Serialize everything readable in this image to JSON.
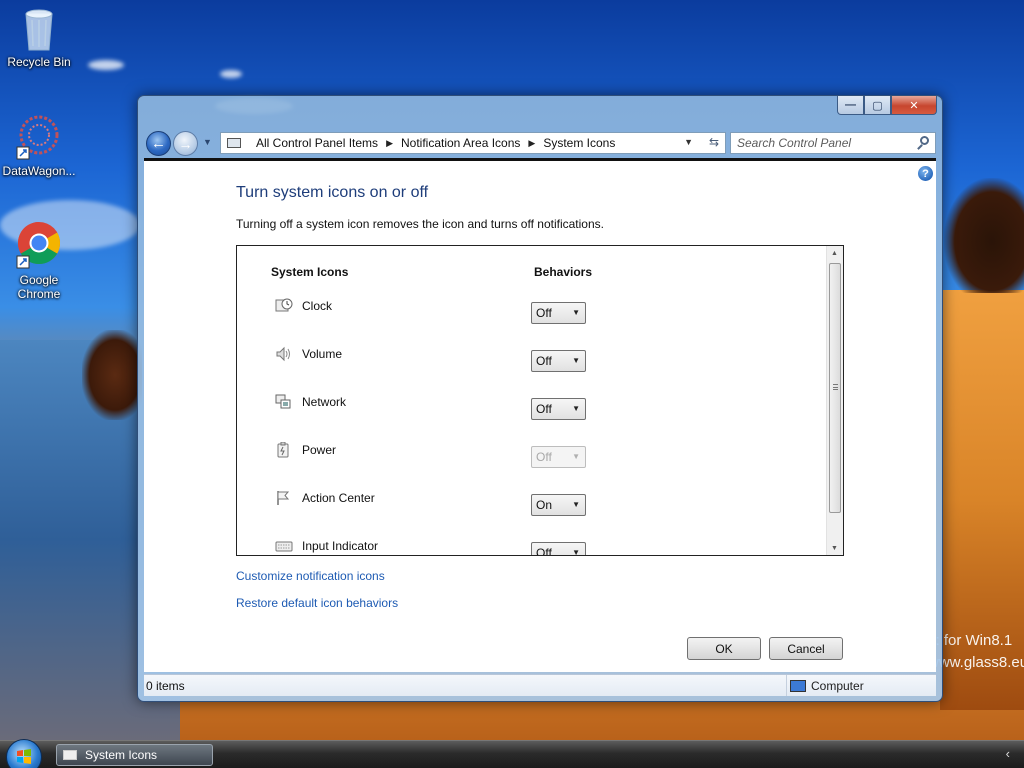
{
  "desktop": {
    "icons": [
      {
        "label": "Recycle Bin"
      },
      {
        "label": "DataWagon..."
      },
      {
        "label": "Google Chrome"
      }
    ],
    "watermark": [
      "s: for Win8.1",
      "www.glass8.eu"
    ]
  },
  "window": {
    "caption_buttons": {
      "minimize": "—",
      "maximize": "▢",
      "close": "✕"
    },
    "nav": {
      "back": "←",
      "forward": "→"
    },
    "breadcrumbs": [
      "All Control Panel Items",
      "Notification Area Icons",
      "System Icons"
    ],
    "search_placeholder": "Search Control Panel",
    "help": "?",
    "title": "Turn system icons on or off",
    "description": "Turning off a system icon removes the icon and turns off notifications.",
    "columns": {
      "icons": "System Icons",
      "behaviors": "Behaviors"
    },
    "rows": [
      {
        "label": "Clock",
        "value": "Off",
        "icon": "clock-icon",
        "disabled": false
      },
      {
        "label": "Volume",
        "value": "Off",
        "icon": "volume-icon",
        "disabled": false
      },
      {
        "label": "Network",
        "value": "Off",
        "icon": "network-icon",
        "disabled": false
      },
      {
        "label": "Power",
        "value": "Off",
        "icon": "power-icon",
        "disabled": true
      },
      {
        "label": "Action Center",
        "value": "On",
        "icon": "flag-icon",
        "disabled": false
      },
      {
        "label": "Input Indicator",
        "value": "Off",
        "icon": "keyboard-icon",
        "disabled": false
      }
    ],
    "links": {
      "customize": "Customize notification icons",
      "restore": "Restore default icon behaviors"
    },
    "buttons": {
      "ok": "OK",
      "cancel": "Cancel"
    },
    "status": {
      "items": "0 items",
      "location": "Computer"
    }
  },
  "taskbar": {
    "items": [
      {
        "label": "System Icons"
      }
    ],
    "tray_chevron": "‹"
  }
}
